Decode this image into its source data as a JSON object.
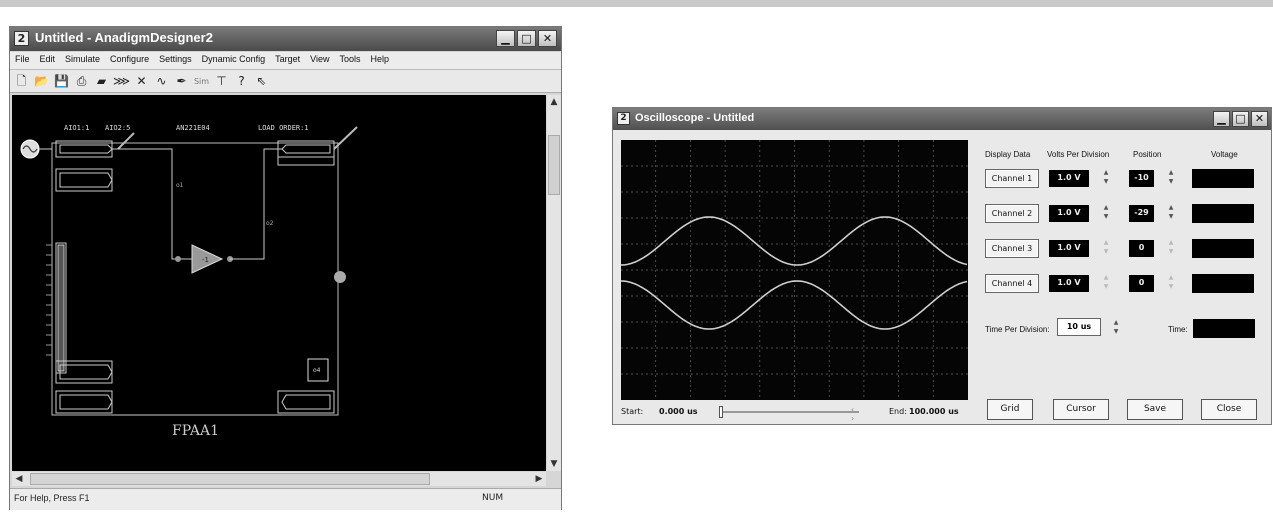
{
  "window1": {
    "title": "Untitled - AnadigmDesigner2",
    "menu": [
      "File",
      "Edit",
      "Simulate",
      "Configure",
      "Settings",
      "Dynamic Config",
      "Target",
      "View",
      "Tools",
      "Help"
    ],
    "toolbar": {
      "sim_label": "Sim"
    },
    "canvas": {
      "label_aio1": "AIO1:1",
      "label_aio2": "AIO2:5",
      "label_amp": "AN221E04",
      "label_load": "LOAD ORDER:1",
      "label_fpaa": "FPAA1",
      "label_o1": "o1",
      "label_o2": "o2",
      "label_amp_gain": "-1",
      "label_box": "o4"
    },
    "status": {
      "message": "For Help, Press F1",
      "num": "NUM"
    }
  },
  "window2": {
    "title": "Oscilloscope - Untitled",
    "headers": {
      "display_data": "Display Data",
      "volts_per_division": "Volts Per Division",
      "position": "Position",
      "voltage": "Voltage"
    },
    "channels": [
      {
        "label": "Channel 1",
        "volts": "1.0 V",
        "position": "-10",
        "voltage": "",
        "enabled": true
      },
      {
        "label": "Channel 2",
        "volts": "1.0 V",
        "position": "-29",
        "voltage": "",
        "enabled": true
      },
      {
        "label": "Channel 3",
        "volts": "1.0 V",
        "position": "0",
        "voltage": "",
        "enabled": false
      },
      {
        "label": "Channel 4",
        "volts": "1.0 V",
        "position": "0",
        "voltage": "",
        "enabled": false
      }
    ],
    "time_per_division_label": "Time Per Division:",
    "time_per_division": "10 us",
    "time_label": "Time:",
    "time_value": "",
    "start_label": "Start:",
    "start_value": "0.000 us",
    "end_label": "End:",
    "end_value": "100.000 us",
    "buttons": {
      "grid": "Grid",
      "cursor": "Cursor",
      "save": "Save",
      "close": "Close"
    }
  }
}
